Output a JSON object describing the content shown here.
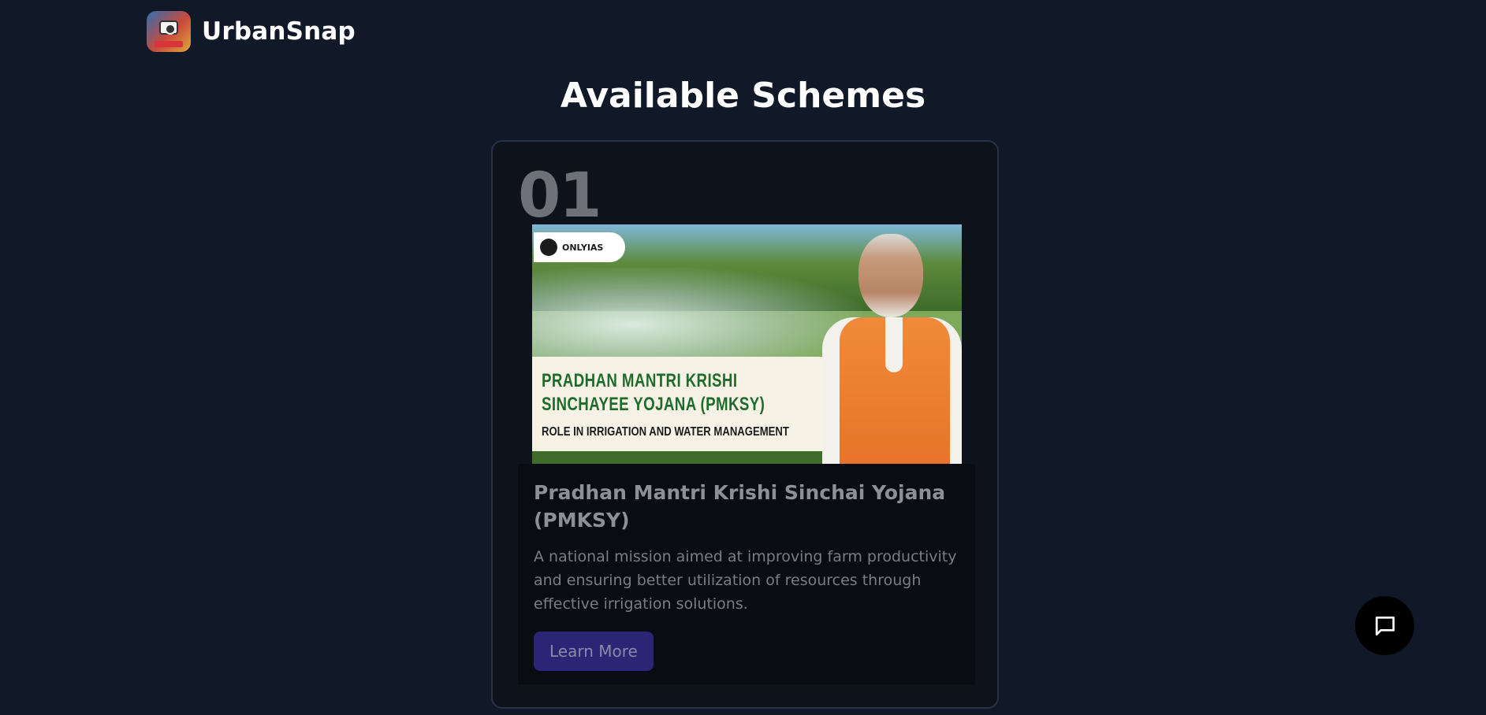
{
  "header": {
    "brand_name": "UrbanSnap",
    "logo_icon": "urbansnap-camera-logo"
  },
  "page": {
    "title": "Available Schemes"
  },
  "schemes": [
    {
      "number": "01",
      "image": {
        "badge_text": "ONLYIAS",
        "headline_line1": "PRADHAN MANTRI KRISHI",
        "headline_line2": "SINCHAYEE YOJANA (PMKSY)",
        "subline": "ROLE IN IRRIGATION AND WATER MANAGEMENT"
      },
      "title": "Pradhan Mantri Krishi Sinchai Yojana (PMKSY)",
      "description": "A national mission aimed at improving farm productivity and ensuring better utilization of resources through effective irrigation solutions.",
      "button_label": "Learn More"
    }
  ],
  "chat": {
    "icon": "chat-bubble-icon"
  },
  "colors": {
    "background": "#111827",
    "card_background": "#0e121a",
    "card_border": "#283246",
    "button_background": "#2a2575",
    "chat_button": "#000000"
  }
}
